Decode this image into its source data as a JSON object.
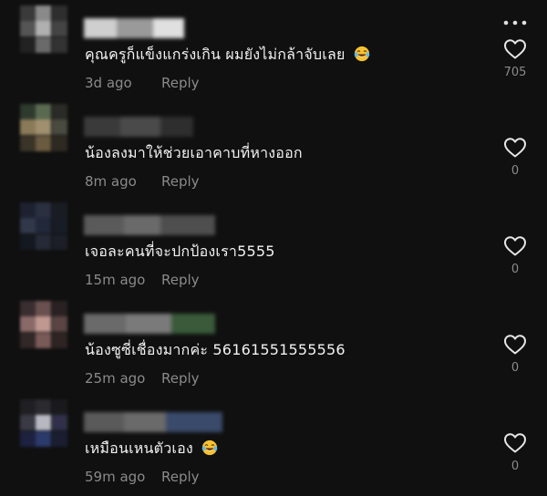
{
  "comments": [
    {
      "text": "คุณครูก็แข็งแกร่งเกิน ผมยังไม่กล้าจับเลย",
      "emoji": "laughing-tears-emoji",
      "time": "3d ago",
      "reply": "Reply",
      "likes": "705",
      "avatar_colors": [
        "#3a3a3a",
        "#8a8a8a",
        "#2e2e2e",
        "#555",
        "#b0b0b0",
        "#444",
        "#222",
        "#6a6a6a",
        "#333"
      ],
      "name_colors": [
        "#cfcfcf",
        "#9a9a9a",
        "#e0e0e0"
      ]
    },
    {
      "text": "น้องลงมาให้ช่วยเอาคาบที่หางออก",
      "emoji": "",
      "time": "8m ago",
      "reply": "Reply",
      "likes": "0",
      "avatar_colors": [
        "#2f3a2e",
        "#5a6a50",
        "#2a2a26",
        "#8a7a58",
        "#a09070",
        "#4a4a40",
        "#3a3428",
        "#6a5a40",
        "#2e2a22"
      ],
      "name_colors": [
        "#3a3a3a",
        "#4a4a4a",
        "#2e2e2e"
      ]
    },
    {
      "text": "เจอละคนที่จะปกป้องเรา5555",
      "emoji": "",
      "time": "15m ago",
      "reply": "Reply",
      "likes": "0",
      "avatar_colors": [
        "#1e2230",
        "#2a3040",
        "#1a1c24",
        "#30384a",
        "#20283a",
        "#181c26",
        "#141820",
        "#262a36",
        "#1c1e28"
      ],
      "name_colors": [
        "#5a5a5a",
        "#6a6a6a",
        "#4e4e4e"
      ]
    },
    {
      "text": "น้องซูซี่เชื่องมากค่ะ 56161551555556",
      "emoji": "",
      "time": "25m ago",
      "reply": "Reply",
      "likes": "0",
      "avatar_colors": [
        "#3a2e30",
        "#6a5050",
        "#2a2222",
        "#8a6a68",
        "#c09890",
        "#5a4444",
        "#322828",
        "#7a5a58",
        "#2e2424"
      ],
      "name_colors": [
        "#6a6a6a",
        "#7a7a7a",
        "#3a5a3a"
      ]
    },
    {
      "text": "เหมือนเหนตัวเอง",
      "emoji": "laughing-tears-emoji",
      "time": "59m ago",
      "reply": "Reply",
      "likes": "0",
      "avatar_colors": [
        "#202024",
        "#2a2a30",
        "#1a1a1e",
        "#3a3a44",
        "#b8b8c0",
        "#30304a",
        "#1e2240",
        "#2a3a6a",
        "#1a1e30"
      ],
      "name_colors": [
        "#5a5a5a",
        "#6a6a6a",
        "#3a4a6a"
      ]
    }
  ],
  "icons": {
    "more": "more-dots-icon",
    "heart": "heart-outline-icon"
  },
  "colors": {
    "background": "#101010",
    "text": "#f2f2f2",
    "meta": "#8a8a8a"
  }
}
